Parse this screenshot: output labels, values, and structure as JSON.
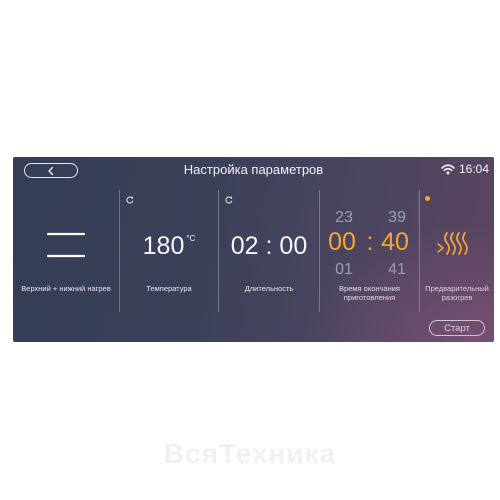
{
  "header": {
    "title": "Настройка параметров",
    "time": "16:04"
  },
  "panels": {
    "mode": {
      "label": "Верхний + нижний нагрев"
    },
    "temperature": {
      "value": "180",
      "unit": "°C",
      "label": "Температура"
    },
    "duration": {
      "value": "02 : 00",
      "label": "Длительность"
    },
    "end_time": {
      "hours": [
        "23",
        "00",
        "01"
      ],
      "separator": ":",
      "minutes": [
        "39",
        "40",
        "41"
      ],
      "label": "Время окончания приготовления"
    },
    "preheat": {
      "label": "Предварительный разогрев"
    }
  },
  "footer": {
    "start_label": "Старт"
  },
  "watermark": "ВсяТехника",
  "colors": {
    "accent": "#f5a532",
    "background": "#3b4159",
    "text": "#f2f2f6"
  },
  "icons": {
    "back": "back-arrow-icon",
    "wifi": "wifi-icon",
    "mode": "top-bottom-heating-icon",
    "reset": "reset-icon",
    "preheat": "preheat-icon"
  }
}
